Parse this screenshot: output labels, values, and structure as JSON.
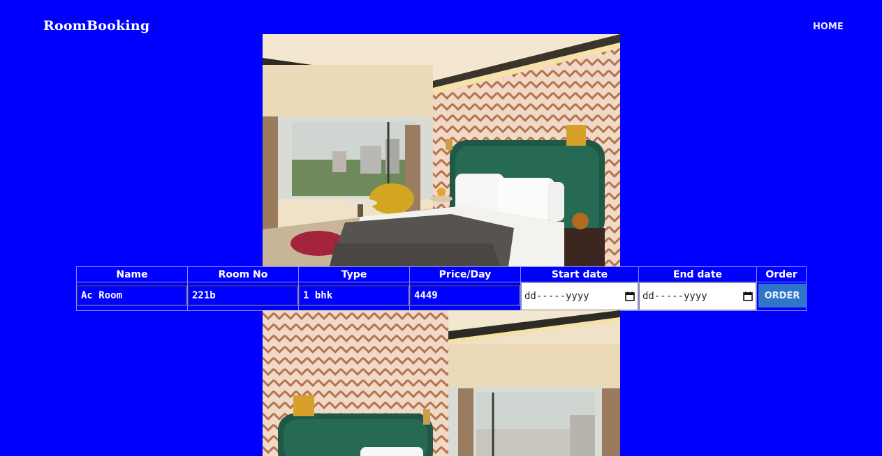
{
  "nav": {
    "brand": "RoomBooking",
    "home_label": "HOME"
  },
  "table": {
    "headers": [
      "Name",
      "Room No",
      "Type",
      "Price/Day",
      "Start date",
      "End date",
      "Order"
    ],
    "row": {
      "name": "Ac Room",
      "room_no": "221b",
      "type": "1 bhk",
      "price": "4449",
      "start_date_placeholder": "dd-----yyyy",
      "end_date_placeholder": "dd-----yyyy",
      "order_label": "ORDER"
    }
  },
  "icons": {
    "calendar": "calendar-icon"
  },
  "colors": {
    "background": "#0000ff",
    "order_button": "#2f76c9"
  }
}
